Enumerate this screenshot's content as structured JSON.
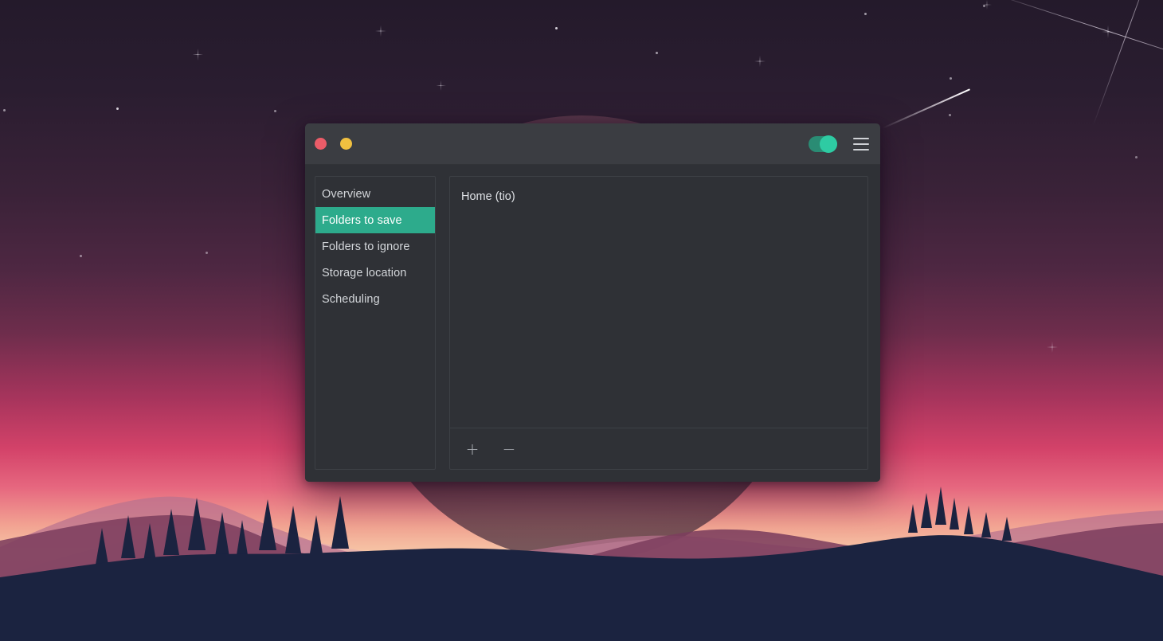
{
  "window": {
    "titlebar": {
      "close_label": "Close",
      "minimize_label": "Minimize",
      "power_toggle": {
        "state": "on",
        "accent_color": "#2ecba3",
        "track_color": "#2a8c74"
      },
      "menu_label": "Menu"
    },
    "accent_color": "#2dab8c",
    "background_color": "#2f3136",
    "titlebar_color": "#3b3d42",
    "text_color": "#d3d6da"
  },
  "sidebar": {
    "items": [
      {
        "label": "Overview",
        "selected": false
      },
      {
        "label": "Folders to save",
        "selected": true
      },
      {
        "label": "Folders to ignore",
        "selected": false
      },
      {
        "label": "Storage location",
        "selected": false
      },
      {
        "label": "Scheduling",
        "selected": false
      }
    ]
  },
  "main": {
    "folder_list": {
      "rows": [
        {
          "label": "Home (tio)"
        }
      ]
    },
    "toolbar": {
      "add_label": "+",
      "remove_label": "−"
    }
  },
  "desktop": {
    "wallpaper": {
      "description": "Sunset mountain landscape with starry purple sky",
      "sky_top_color": "#241a2b",
      "sky_sunset_color": "#f2a392",
      "hill_far_color": "#d291a8",
      "hill_mid_color": "#b06e8c",
      "hill_near_color": "#7d3f5f",
      "foreground_color": "#1b2340"
    }
  }
}
